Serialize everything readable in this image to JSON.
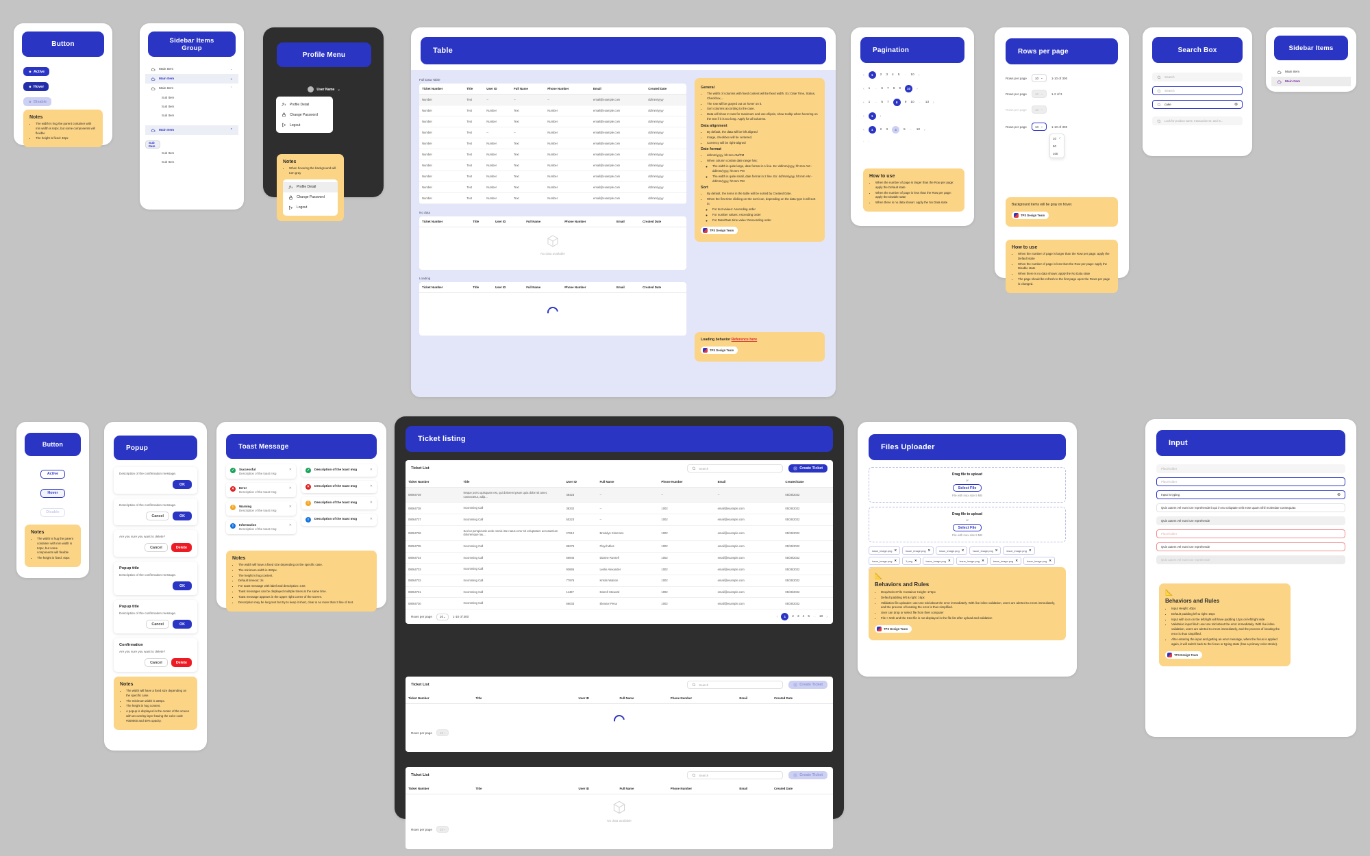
{
  "meta": {
    "accent": "#2b35c4",
    "note_bg": "#fbd486",
    "danger": "#ed1c24",
    "board_bg": "#c4c4c4"
  },
  "button_card": {
    "title": "Button",
    "states": [
      {
        "label": "Active",
        "icon": "gear-icon"
      },
      {
        "label": "Hover",
        "icon": "gear-icon"
      },
      {
        "label": "Disable",
        "icon": "gear-icon"
      }
    ],
    "notes": {
      "heading": "Notes",
      "items": [
        "The width is hug the parent container with min width is 64px, but some components will flexible",
        "The height is fixed: 40px"
      ]
    }
  },
  "sidebar_group_card": {
    "title": "Sidebar Items Group",
    "rows": [
      {
        "label": "Main Item",
        "state": "default",
        "chevron": "chevron-down-icon"
      },
      {
        "label": "Main Item",
        "state": "hover",
        "chevron": "chevron-down-icon"
      },
      {
        "label": "Main Item",
        "state": "expanded",
        "chevron": "chevron-up-icon"
      },
      {
        "label": "Main Item",
        "state": "expanded-selected",
        "chevron": "chevron-up-icon"
      }
    ],
    "sub_items": [
      "Sub Item",
      "Sub Item",
      "Sub Item"
    ],
    "sub_items_2": [
      "Sub Item",
      "Sub Item",
      "Sub Item"
    ]
  },
  "profile_menu_card": {
    "title": "Profile Menu",
    "user_name": "User Name",
    "menu": [
      {
        "label": "Profile Detail",
        "icon": "user-profile-icon"
      },
      {
        "label": "Change Password",
        "icon": "lock-icon"
      },
      {
        "label": "Logout",
        "icon": "logout-icon"
      }
    ],
    "notes": {
      "heading": "Notes",
      "items": [
        "When hovering the background will turn gray"
      ]
    }
  },
  "table_card": {
    "title": "Table",
    "sections": {
      "full": "Full Data Table",
      "no_data": "No data",
      "loading": "Loading"
    },
    "columns": [
      "Ticket Number",
      "Title",
      "User ID",
      "Full Name",
      "Phone Number",
      "Email",
      "Created Date"
    ],
    "rows": [
      [
        "Number",
        "Text",
        "--",
        "--",
        "--",
        "email@example.com",
        "dd/mm/yyyy"
      ],
      [
        "Number",
        "Text",
        "Number",
        "Text",
        "Number",
        "email@example.com",
        "dd/mm/yyyy"
      ],
      [
        "Number",
        "Text",
        "Number",
        "Text",
        "Number",
        "email@example.com",
        "dd/mm/yyyy"
      ],
      [
        "Number",
        "Text",
        "--",
        "--",
        "Number",
        "email@example.com",
        "dd/mm/yyyy"
      ],
      [
        "Number",
        "Text",
        "Number",
        "Text",
        "Number",
        "email@example.com",
        "dd/mm/yyyy"
      ],
      [
        "Number",
        "Text",
        "Number",
        "Text",
        "Number",
        "email@example.com",
        "dd/mm/yyyy"
      ],
      [
        "Number",
        "Text",
        "Number",
        "Text",
        "Number",
        "email@example.com",
        "dd/mm/yyyy"
      ],
      [
        "Number",
        "Text",
        "Number",
        "Text",
        "Number",
        "email@example.com",
        "dd/mm/yyyy"
      ],
      [
        "Number",
        "Text",
        "Number",
        "Text",
        "Number",
        "email@example.com",
        "dd/mm/yyyy"
      ],
      [
        "Number",
        "Text",
        "Number",
        "Text",
        "Number",
        "email@example.com",
        "dd/mm/yyyy"
      ]
    ],
    "empty_text": "No data available",
    "notes": {
      "groups": [
        {
          "heading": "General",
          "items": [
            "The width of columns with fixed content will be fixed width. Ex: Date Time, Status, Checkbox,...",
            "The row will be grayed out on hover on it.",
            "Sort columns according to the case.",
            "Data will show 2 rows for maximum and use ellipsis, show tooltip when hovering on the text if it is too long. Apply for all columns."
          ]
        },
        {
          "heading": "Data alignment",
          "items": [
            "By default, the data will be left aligned",
            "Image, checkbox will be centered.",
            "Currency will be right-aligned"
          ]
        },
        {
          "heading": "Date format",
          "items": [
            "dd/mm/yyyy, hh:mm AM/PM",
            "When column contain date range has:"
          ],
          "subitems": [
            "The width is quite large, date format in 1 line. Ex: dd/mm/yyyy, hh:mm AM - dd/mm/yyyy, hh:mm PM",
            "The width is quite small, date format in 2 line. Ex: dd/mm/yyyy, hh:mm AM - dd/mm/yyyy, hh:mm PM"
          ]
        },
        {
          "heading": "Sort",
          "items": [
            "By default, the items in the table will be sorted by Created Date.",
            "When the first time clicking on the sort icon, depending on the data type it will sort in:"
          ],
          "subitems": [
            "For text values: Ascending order",
            "For number values: Ascending order",
            "For Date/Date time value: Descending order"
          ]
        }
      ],
      "tag": "TPS Design Team"
    },
    "loading_note": {
      "label": "Loading behavior",
      "link": "Reference here",
      "tag": "TPS Design Team"
    }
  },
  "pagination_card": {
    "title": "Pagination",
    "rows": [
      {
        "prev": "‹",
        "items": [
          "1",
          "2",
          "3",
          "4",
          "5",
          "...",
          "10"
        ],
        "active": "1",
        "next": "›"
      },
      {
        "prev": "‹",
        "items": [
          "1",
          "...",
          "6",
          "7",
          "8",
          "9",
          "10"
        ],
        "active": "10",
        "next": "›"
      },
      {
        "prev": "‹",
        "items": [
          "1",
          "...",
          "6",
          "7",
          "8",
          "9",
          "10",
          "...",
          "13"
        ],
        "active": "8",
        "next": "›"
      },
      {
        "prev": "‹",
        "items": [
          "1"
        ],
        "active": "1",
        "next": "›"
      },
      {
        "prev": "‹",
        "items": [
          "1",
          "2",
          "3",
          "4",
          "5",
          "...",
          "10"
        ],
        "active": "1",
        "hover": "4",
        "next": "›"
      },
      {
        "prev": "‹",
        "items": [],
        "active": "",
        "next": "›",
        "disabled": true
      }
    ],
    "notes": {
      "heading": "How to use",
      "items": [
        "When the number of page is larger than the Row per page: apply the Default state",
        "When the number of page is less than the Row per page: apply the Disable state",
        "When there is no data shown: apply the No Data state"
      ]
    }
  },
  "rows_per_page_card": {
    "title": "Rows per page",
    "rows": [
      {
        "label": "Rows per page",
        "value": "10",
        "range": "1-10 of 300",
        "state": "default"
      },
      {
        "label": "Rows per page",
        "value": "10",
        "range": "1-2 of 3",
        "state": "disabled"
      },
      {
        "label": "Rows per page",
        "value": "10",
        "range": "",
        "state": "disabled"
      },
      {
        "label": "Rows per page",
        "value": "10",
        "range": "1-10 of 300",
        "state": "open"
      }
    ],
    "options": [
      "10",
      "50",
      "100"
    ],
    "selected_option": "10",
    "hover_note": {
      "text": "Background items will be gray on hover.",
      "tag": "TPS Design Team"
    },
    "notes": {
      "heading": "How to use",
      "items": [
        "When the number of page is larger than the Row per page: apply the Default state",
        "When the number of page is less than the Row per page: apply the Disable state",
        "When there is no data shown: apply the No Data state",
        "The page should be refresh to the first page upon the Rows per page is changed."
      ]
    }
  },
  "search_box_card": {
    "title": "Search Box",
    "fields": [
      {
        "state": "default",
        "value": "",
        "placeholder": "Search",
        "clear": false
      },
      {
        "state": "focus",
        "value": "",
        "placeholder": "Search",
        "clear": false
      },
      {
        "state": "typing",
        "value": "cake",
        "placeholder": "Search",
        "clear": true
      },
      {
        "state": "long-placeholder",
        "value": "",
        "placeholder": "Look for product name, transaction ID, and m...",
        "clear": false
      }
    ]
  },
  "sidebar_items_card": {
    "title": "Sidebar Items",
    "items": [
      {
        "label": "Main Item",
        "state": "default"
      },
      {
        "label": "Main Item",
        "state": "selected"
      }
    ]
  },
  "button_card_2": {
    "title": "Button",
    "states": [
      "Active",
      "Hover",
      "Disable"
    ],
    "notes": {
      "heading": "Notes",
      "items": [
        "The width is hug the parent container with min width is 64px, but some components will flexible",
        "The height is fixed: 40px"
      ]
    }
  },
  "popup_card": {
    "title": "Popup",
    "popups": [
      {
        "title": "",
        "desc": "Description of the confirmation message.",
        "buttons": [
          {
            "label": "OK",
            "type": "primary"
          }
        ]
      },
      {
        "title": "",
        "desc": "Description of the confirmation message.",
        "buttons": [
          {
            "label": "Cancel",
            "type": "ghost"
          },
          {
            "label": "OK",
            "type": "primary"
          }
        ]
      },
      {
        "title": "",
        "desc": "Are you sure you want to delete?",
        "buttons": [
          {
            "label": "Cancel",
            "type": "ghost"
          },
          {
            "label": "Delete",
            "type": "danger"
          }
        ]
      },
      {
        "title": "Popup title",
        "desc": "Description of the confirmation message.",
        "buttons": [
          {
            "label": "OK",
            "type": "primary"
          }
        ]
      },
      {
        "title": "Popup title",
        "desc": "Description of the confirmation message.",
        "buttons": [
          {
            "label": "Cancel",
            "type": "ghost"
          },
          {
            "label": "OK",
            "type": "primary"
          }
        ]
      },
      {
        "title": "Confirmation",
        "desc": "Are you sure you want to delete?",
        "buttons": [
          {
            "label": "Cancel",
            "type": "ghost"
          },
          {
            "label": "Delete",
            "type": "danger"
          }
        ]
      }
    ],
    "notes": {
      "heading": "Notes",
      "items": [
        "The width will have a fixed size depending on the specific case.",
        "The minimum width is 320px.",
        "The height is hug content.",
        "A popup is displayed in the center of the screen with an overlay layer having the color code #000000 and 40% opacity."
      ]
    }
  },
  "toast_card": {
    "title": "Toast Message",
    "left": [
      {
        "type": "success",
        "title": "Successful",
        "desc": "Description of the toast msg",
        "color": "#1aa35a",
        "glyph": "✓"
      },
      {
        "type": "error",
        "title": "Error",
        "desc": "Description of the toast msg",
        "color": "#e02020",
        "glyph": "✕"
      },
      {
        "type": "warning",
        "title": "Warning",
        "desc": "Description of the toast msg",
        "color": "#f5a623",
        "glyph": "!"
      },
      {
        "type": "information",
        "title": "Information",
        "desc": "Description of the toast msg",
        "color": "#1574e0",
        "glyph": "i"
      }
    ],
    "right": [
      {
        "type": "success",
        "title": "Description of the toast msg",
        "color": "#1aa35a",
        "glyph": "✓"
      },
      {
        "type": "error",
        "title": "Description of the toast msg",
        "color": "#e02020",
        "glyph": "✕"
      },
      {
        "type": "warning",
        "title": "Description of the toast msg",
        "color": "#f5a623",
        "glyph": "!"
      },
      {
        "type": "information",
        "title": "Description of the toast msg",
        "color": "#1574e0",
        "glyph": "i"
      }
    ],
    "notes": {
      "heading": "Notes",
      "items": [
        "The width will have a fixed size depending on the specific case.",
        "The minimum width is 320px.",
        "The height is hug content.",
        "Default timeout: 2s",
        "For toast message with label and description: 3.5s",
        "Toast messages can be displayed multiple times at the same time.",
        "Toast message appears in the upper right corner of the screen.",
        "Description may be long text but try to keep it short, clear & no more than 3 line of text."
      ]
    }
  },
  "ticket_listing_card": {
    "title": "Ticket listing",
    "panel_title": "Ticket List",
    "search_placeholder": "Search",
    "create_button": "Create Ticket",
    "columns": [
      "Ticket Number",
      "Title",
      "User ID",
      "Full Name",
      "Phone Number",
      "Email",
      "Created Date"
    ],
    "rows": [
      [
        "08064739",
        "Neque porro quisquam est, qui dolorem ipsum quia dolor sit amet, consectetur, adip...",
        "48423",
        "--",
        "--",
        "--",
        "05/26/2022"
      ],
      [
        "08064738",
        "Incomming Call",
        "39332",
        "--",
        "1002",
        "email@example.com",
        "05/26/2022"
      ],
      [
        "08064737",
        "Incomming Call",
        "50223",
        "--",
        "1002",
        "email@example.com",
        "05/26/2022"
      ],
      [
        "08064736",
        "Sed ut perspiciatis unde omnis iste natus error sit voluptatem accusantium doloremque lau...",
        "27912",
        "Brooklyn Simmons",
        "1002",
        "email@example.com",
        "05/26/2022"
      ],
      [
        "08064735",
        "Incomming Call",
        "88276",
        "Floyd Miles",
        "1002",
        "email@example.com",
        "05/26/2022"
      ],
      [
        "08064734",
        "Incomming Call",
        "66945",
        "Dianne Russell",
        "1002",
        "email@example.com",
        "05/26/2022"
      ],
      [
        "08064733",
        "Incomming Call",
        "93665",
        "Leslie Alexander",
        "1002",
        "email@example.com",
        "05/26/2022"
      ],
      [
        "08064732",
        "Incomming Call",
        "77976",
        "Kristin Watson",
        "1002",
        "email@example.com",
        "05/26/2022"
      ],
      [
        "08064731",
        "Incomming Call",
        "11487",
        "Darrell Steward",
        "1002",
        "email@example.com",
        "05/26/2022"
      ],
      [
        "08064730",
        "Incomming Call",
        "66033",
        "Eleanor Pena",
        "1002",
        "email@example.com",
        "05/26/2022"
      ]
    ],
    "footer": {
      "rows_label": "Rows per page",
      "rows_value": "10",
      "range": "1-10 of 300",
      "pages": [
        "1",
        "2",
        "3",
        "4",
        "5",
        "...",
        "10"
      ],
      "active": "1"
    },
    "loading_panel": {
      "title": "Ticket List",
      "search_placeholder": "Search",
      "create_button": "Create Ticket"
    },
    "empty_panel": {
      "title": "Ticket List",
      "search_placeholder": "Search",
      "create_button": "Create Ticket",
      "empty_text": "No data available"
    }
  },
  "files_uploader_card": {
    "title": "Files Uploader",
    "dropzones": [
      {
        "t1": "Drag file to upload",
        "t2": "or",
        "button": "Select File",
        "t3": "File with max size 5 MB"
      },
      {
        "t1": "Drag file to upload",
        "t2": "or",
        "button": "Select File",
        "t3": "File with max size 5 MB"
      }
    ],
    "files": [
      "issue_image.png",
      "issue_image.png",
      "issue_image.png",
      "issue_image.png",
      "issue_image.png",
      "issue_image.png",
      "1.png",
      "issue_image.png",
      "issue_image.png",
      "issue_image.png",
      "issue_image.png",
      "issue_image.png"
    ],
    "notes": {
      "heading": "Behaviors and Rules",
      "items": [
        "Drop/Select File Container Height: 172px",
        "Default padding left & right: 16px",
        "Validation file uploader: user are told about the error immediately. With live inline validation, users are alerted to errors immediately, and the process of locating the error is thus simplified.",
        "User can drop or select file from their computer",
        "File > 5mb and the 21st file is not displayed in the file list after upload and validation"
      ],
      "tag": "TPS Design Team"
    }
  },
  "input_card": {
    "title": "Input",
    "fields": [
      {
        "state": "default",
        "value": "",
        "placeholder": "Placeholder",
        "clear": false
      },
      {
        "state": "focus",
        "value": "",
        "placeholder": "Placeholder",
        "clear": false
      },
      {
        "state": "typing",
        "value": "Input is typing",
        "placeholder": "",
        "clear": true
      },
      {
        "state": "filled",
        "value": "Quis autem vel eum iure reprehenderit qui in ea voluptate velit esse quam nihil molestiae consequatu",
        "placeholder": "",
        "clear": false
      },
      {
        "state": "grey",
        "value": "Quis autem vel eum iure reprehende",
        "placeholder": "",
        "clear": false
      },
      {
        "state": "error",
        "value": "",
        "placeholder": "Placeholder",
        "clear": false
      },
      {
        "state": "error-filled",
        "value": "Quis autem vel eum iure reprehende",
        "placeholder": "",
        "clear": false
      },
      {
        "state": "disabled",
        "value": "Quis autem vel eum iure reprehende",
        "placeholder": "",
        "clear": false
      }
    ],
    "notes": {
      "heading": "Behaviors and Rules",
      "items": [
        "Input Height: 40px",
        "Default padding left & right: 16px",
        "Input with icon on the left/right will have padding 12px on left/right side",
        "Validation input filed: user are told about the error immediately. With live inline validation, users are alerted to errors immediately, and the process of locating the error is thus simplified.",
        "After entering the input and getting an error message, when the focus is applied again, it will switch back to the focus or typing state (has a primary color stroke)."
      ],
      "tag": "TPS Design Team"
    }
  }
}
